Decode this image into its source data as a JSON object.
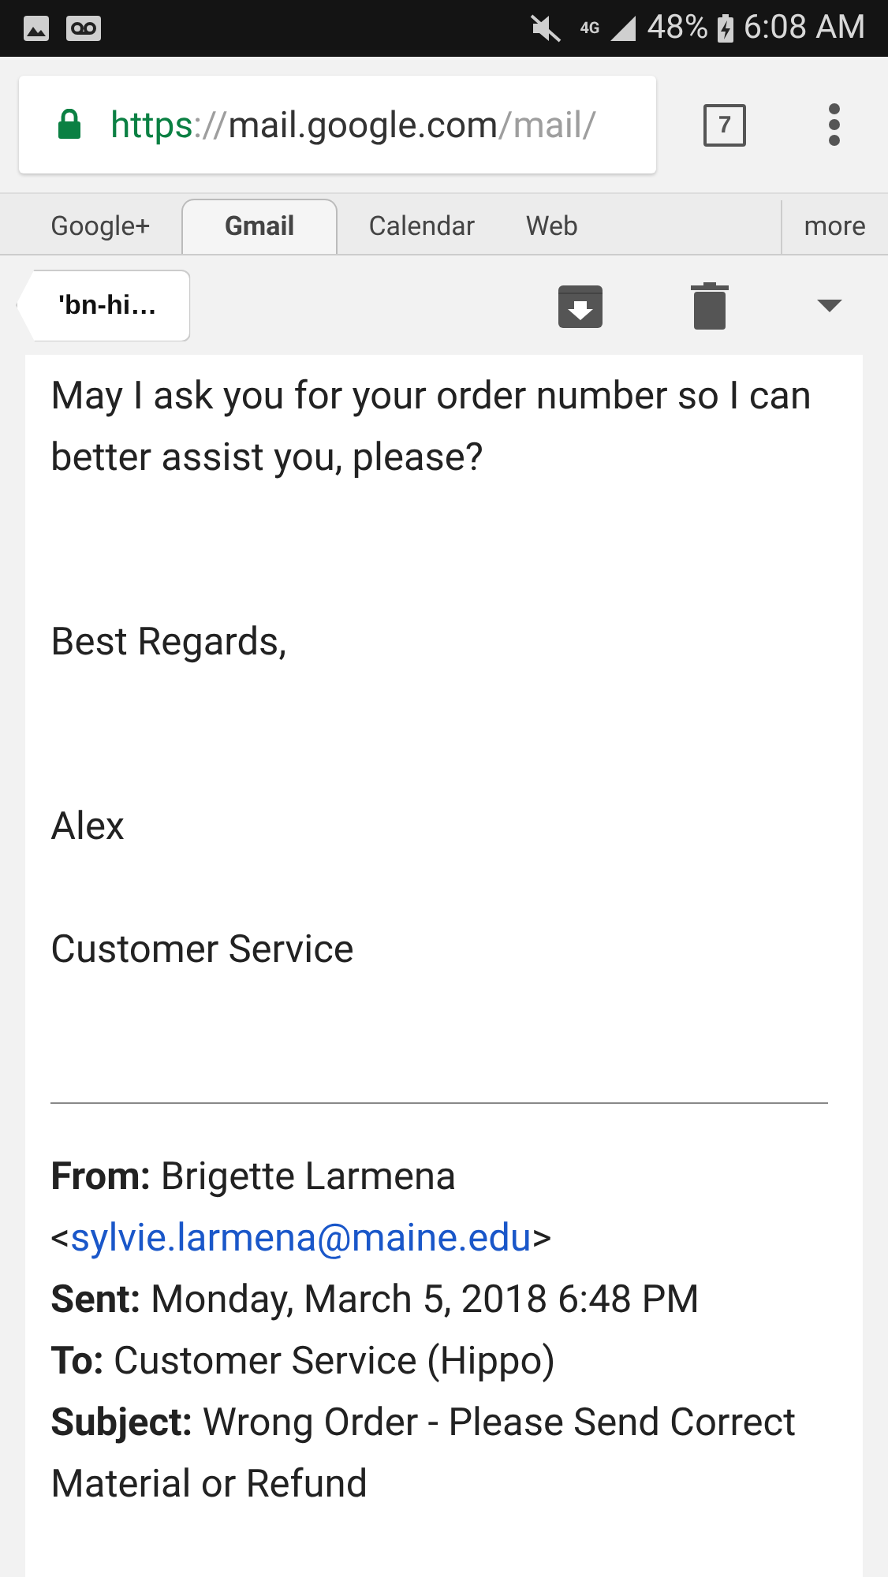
{
  "status_bar": {
    "network": "4G",
    "battery": "48%",
    "time": "6:08 AM"
  },
  "address_bar": {
    "scheme": "https",
    "separator": "://",
    "host": "mail.google.com",
    "path": "/mail/",
    "secure": true
  },
  "tab_count": "7",
  "tabs": [
    {
      "label": "Google+",
      "selected": false
    },
    {
      "label": "Gmail",
      "selected": true
    },
    {
      "label": "Calendar",
      "selected": false
    },
    {
      "label": "Web",
      "selected": false
    },
    {
      "label": "more",
      "selected": false
    }
  ],
  "toolbar": {
    "back_label": "'bn-hi…"
  },
  "message": {
    "paragraphs": [
      "May I ask you for your order number so I can better assist you, please?",
      "Best Regards,",
      "Alex",
      "Customer Service"
    ],
    "quoted_headers": [
      {
        "label": "From:",
        "value": "Brigette Larmena",
        "open": "<",
        "email": "sylvie.larmena@maine.edu",
        "close": ">"
      },
      {
        "label": "Sent:",
        "value": "Monday, March 5, 2018 6:48 PM"
      },
      {
        "label": "To:",
        "value": "Customer Service (Hippo)"
      },
      {
        "label": "Subject:",
        "value": "Wrong Order - Please Send Correct Material or Refund"
      }
    ]
  }
}
